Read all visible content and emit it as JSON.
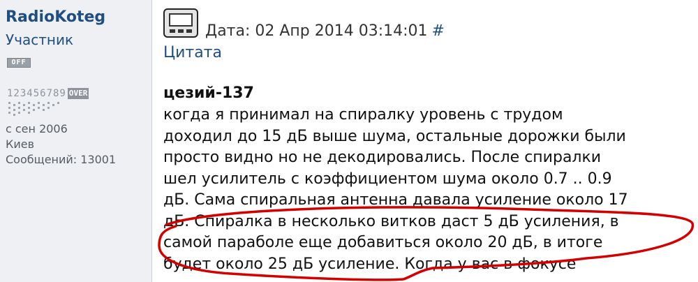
{
  "user": {
    "name": "RadioKoteg",
    "rank": "Участник",
    "status": "OFF",
    "rating_digits": "123456789",
    "rating_over": "OVER",
    "joined": "с сен 2006",
    "city": "Киев",
    "posts": "Сообщений: 13001"
  },
  "post": {
    "date": "Дата: 02 Апр 2014 03:14:01",
    "anchor": "#",
    "quote_link": "Цитата",
    "quote_author": "цезий-137",
    "body_lines": [
      "когда я принимал на спиралку уровень с трудом",
      "доходил до 15 дБ выше шума, остальные дорожки были",
      "просто видно но не декодировались. После спиралки",
      "шел усилитель с коэффициентом шума около 0.7 .. 0.9",
      "дБ. Сама спиральная антенна давала усиление около 17",
      "дБ. Спиралка в несколько витков даст 5 дБ усиления, в",
      "самой параболе еще добавиться около 20 дБ, в итоге",
      "будет около 25 дБ усиление. Когда у вас в фокусе"
    ]
  },
  "colors": {
    "link": "#1f4f82",
    "sidebar_bg": "#eef0f4",
    "annotation": "#d40000"
  },
  "icons": {
    "post_icon": "monitor-icon"
  }
}
